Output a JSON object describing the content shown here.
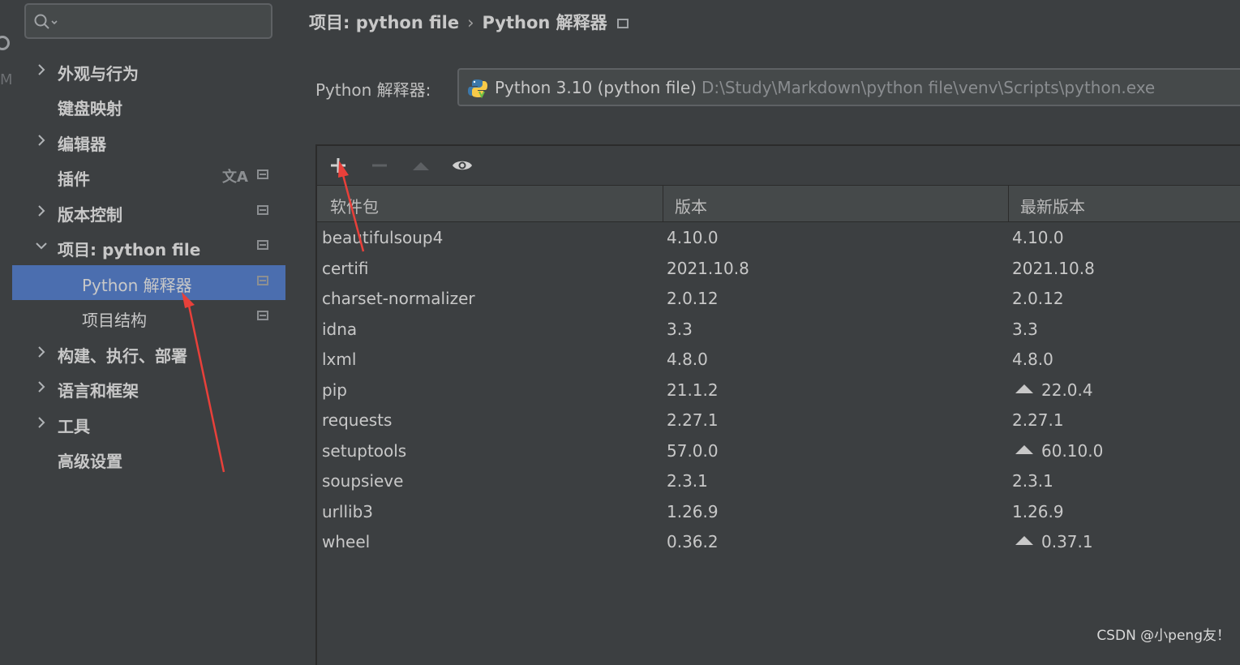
{
  "search": {
    "placeholder": ""
  },
  "sidebar": {
    "items": [
      {
        "label": "外观与行为"
      },
      {
        "label": "键盘映射"
      },
      {
        "label": "编辑器"
      },
      {
        "label": "插件"
      },
      {
        "label": "版本控制"
      },
      {
        "label": "项目: python file"
      },
      {
        "label": "Python 解释器"
      },
      {
        "label": "项目结构"
      },
      {
        "label": "构建、执行、部署"
      },
      {
        "label": "语言和框架"
      },
      {
        "label": "工具"
      },
      {
        "label": "高级设置"
      }
    ],
    "selected": "Python 解释器"
  },
  "breadcrumb": {
    "project": "项目: python file",
    "separator": "›",
    "page": "Python 解释器"
  },
  "interpreter": {
    "label": "Python 解释器:",
    "name": "Python 3.10 (python file)",
    "path": "D:\\Study\\Markdown\\python file\\venv\\Scripts\\python.exe"
  },
  "toolbar": {
    "add": "add-package",
    "remove": "remove-package",
    "upgrade": "upgrade-package",
    "show": "show-early-releases"
  },
  "table": {
    "headers": [
      "软件包",
      "版本",
      "最新版本"
    ],
    "rows": [
      {
        "name": "beautifulsoup4",
        "version": "4.10.0",
        "latest": "4.10.0",
        "upgrade": false
      },
      {
        "name": "certifi",
        "version": "2021.10.8",
        "latest": "2021.10.8",
        "upgrade": false
      },
      {
        "name": "charset-normalizer",
        "version": "2.0.12",
        "latest": "2.0.12",
        "upgrade": false
      },
      {
        "name": "idna",
        "version": "3.3",
        "latest": "3.3",
        "upgrade": false
      },
      {
        "name": "lxml",
        "version": "4.8.0",
        "latest": "4.8.0",
        "upgrade": false
      },
      {
        "name": "pip",
        "version": "21.1.2",
        "latest": "22.0.4",
        "upgrade": true
      },
      {
        "name": "requests",
        "version": "2.27.1",
        "latest": "2.27.1",
        "upgrade": false
      },
      {
        "name": "setuptools",
        "version": "57.0.0",
        "latest": "60.10.0",
        "upgrade": true
      },
      {
        "name": "soupsieve",
        "version": "2.3.1",
        "latest": "2.3.1",
        "upgrade": false
      },
      {
        "name": "urllib3",
        "version": "1.26.9",
        "latest": "1.26.9",
        "upgrade": false
      },
      {
        "name": "wheel",
        "version": "0.36.2",
        "latest": "0.37.1",
        "upgrade": true
      }
    ]
  },
  "watermark": "CSDN @小peng友！",
  "colors": {
    "selection": "#4b6eaf",
    "annotation_arrow": "#e8403a",
    "background": "#3c3f41"
  }
}
